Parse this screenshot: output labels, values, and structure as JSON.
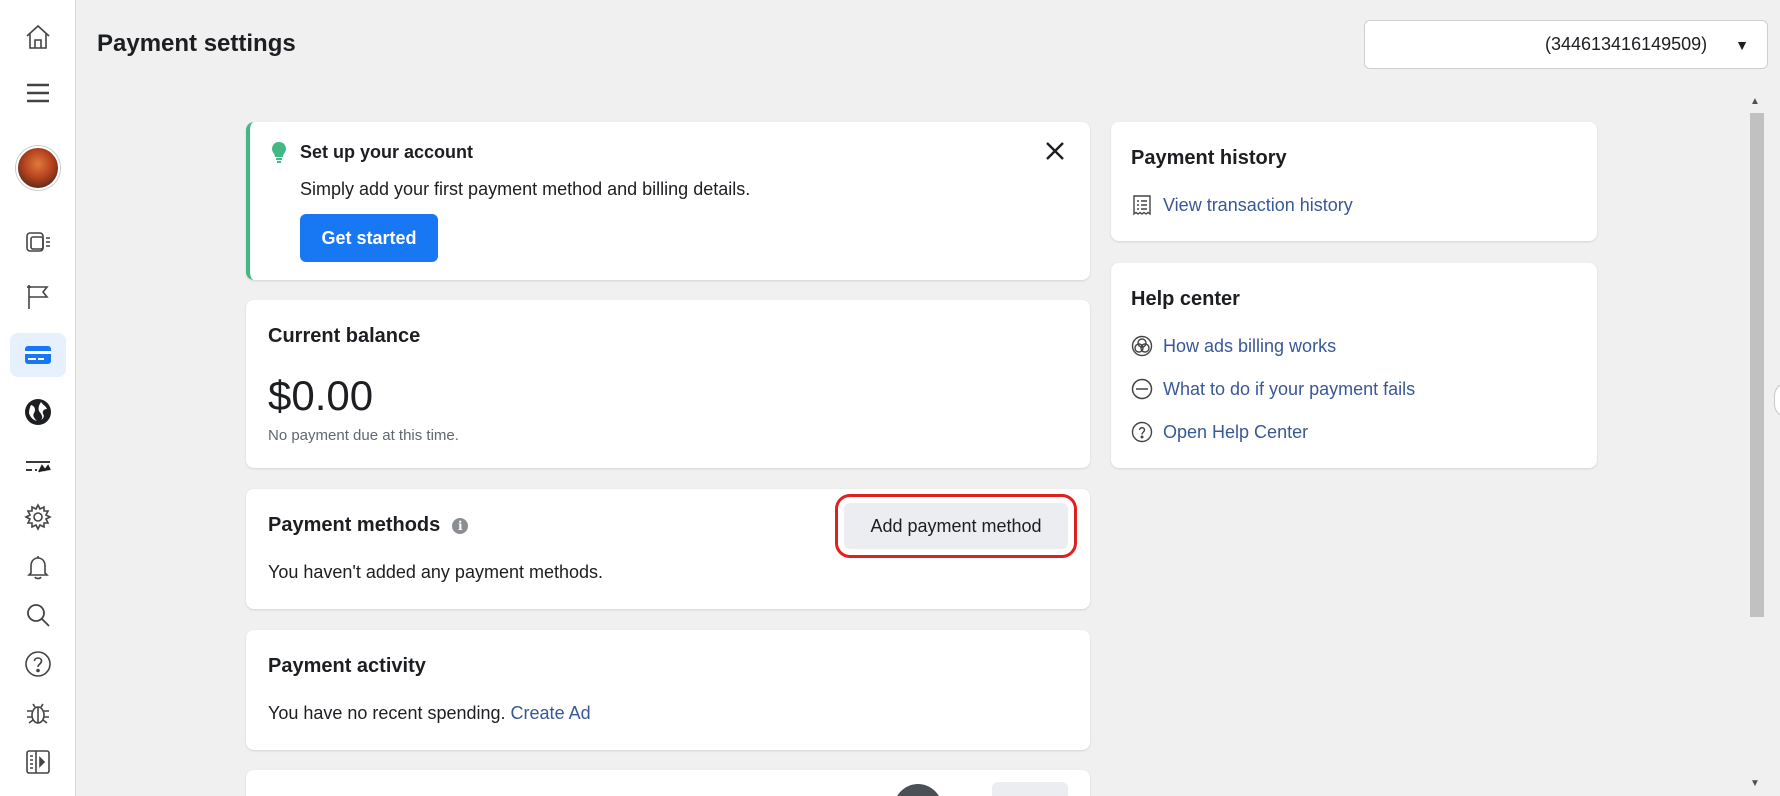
{
  "header": {
    "title": "Payment settings",
    "account_id": "(344613416149509)"
  },
  "rail": {
    "items": [
      {
        "name": "home-icon"
      },
      {
        "name": "menu-icon"
      },
      {
        "name": "avatar"
      },
      {
        "name": "pages-icon"
      },
      {
        "name": "flag-icon"
      },
      {
        "name": "credit-card-icon"
      },
      {
        "name": "globe-icon"
      },
      {
        "name": "ads-manager-icon"
      },
      {
        "name": "gear-icon"
      },
      {
        "name": "bell-icon"
      },
      {
        "name": "search-icon"
      },
      {
        "name": "help-icon"
      },
      {
        "name": "bug-icon"
      },
      {
        "name": "panel-toggle-icon"
      }
    ]
  },
  "setup": {
    "title": "Set up your account",
    "description": "Simply add your first payment method and billing details.",
    "button": "Get started"
  },
  "balance": {
    "title": "Current balance",
    "amount": "$0.00",
    "note": "No payment due at this time."
  },
  "methods": {
    "title": "Payment methods",
    "button": "Add payment method",
    "empty": "You haven't added any payment methods."
  },
  "activity": {
    "title": "Payment activity",
    "text": "You have no recent spending.",
    "link": "Create Ad"
  },
  "history": {
    "title": "Payment history",
    "link": "View transaction history"
  },
  "help": {
    "title": "Help center",
    "links": [
      "How ads billing works",
      "What to do if your payment fails",
      "Open Help Center"
    ]
  },
  "colors": {
    "primary": "#1877f2",
    "link": "#385898",
    "accent_green": "#42b883",
    "highlight_box": "#e02020"
  }
}
